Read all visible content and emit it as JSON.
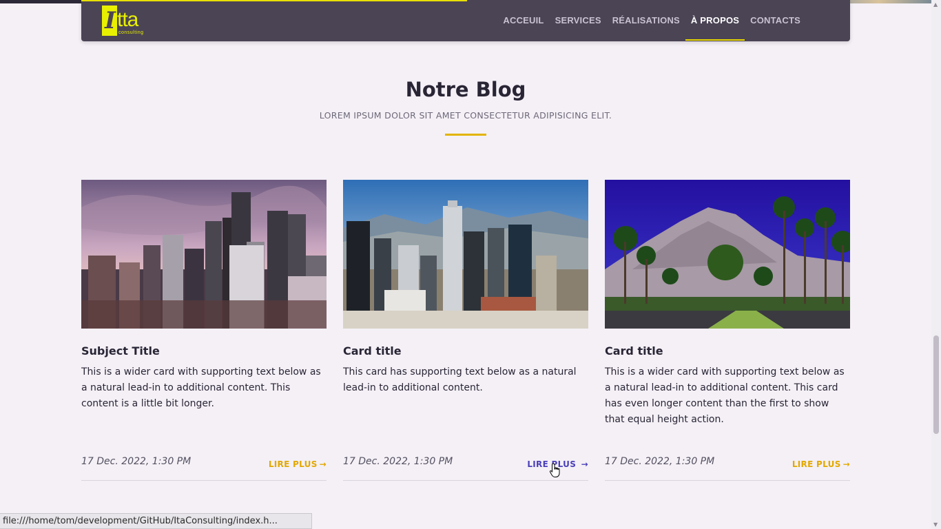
{
  "nav": {
    "logo": {
      "letter": "I",
      "word": "tta",
      "tagline": "consulting"
    },
    "links": [
      {
        "label": "ACCEUIL",
        "active": false
      },
      {
        "label": "SERVICES",
        "active": false
      },
      {
        "label": "RÉALISATIONS",
        "active": false
      },
      {
        "label": "À PROPOS",
        "active": true
      },
      {
        "label": "CONTACTS",
        "active": false
      }
    ],
    "accent_color": "#e8d800"
  },
  "blog": {
    "title": "Notre Blog",
    "subtitle": "LOREM IPSUM DOLOR SIT AMET CONSECTETUR ADIPISICING ELIT.",
    "cards": [
      {
        "image": "city-skyline-sunset-image",
        "title": "Subject Title",
        "text": "This is a wider card with supporting text below as a natural lead-in to additional content. This content is a little bit longer.",
        "date": "17 Dec. 2022, 1:30 PM",
        "more_label": "LIRE PLUS"
      },
      {
        "image": "downtown-los-angeles-image",
        "title": "Card title",
        "text": "This card has supporting text below as a natural lead-in to additional content.",
        "date": "17 Dec. 2022, 1:30 PM",
        "more_label": "LIRE PLUS"
      },
      {
        "image": "palm-trees-mountain-road-image",
        "title": "Card title",
        "text": "This is a wider card with supporting text below as a natural lead-in to additional content. This card has even longer content than the first to show that equal height action.",
        "date": "17 Dec. 2022, 1:30 PM",
        "more_label": "LIRE PLUS"
      }
    ],
    "link_color": "#e2a800",
    "link_hover_color": "#4a3fb8"
  },
  "status_bar": {
    "url": "file:///home/tom/development/GitHub/ItaConsulting/index.h..."
  }
}
